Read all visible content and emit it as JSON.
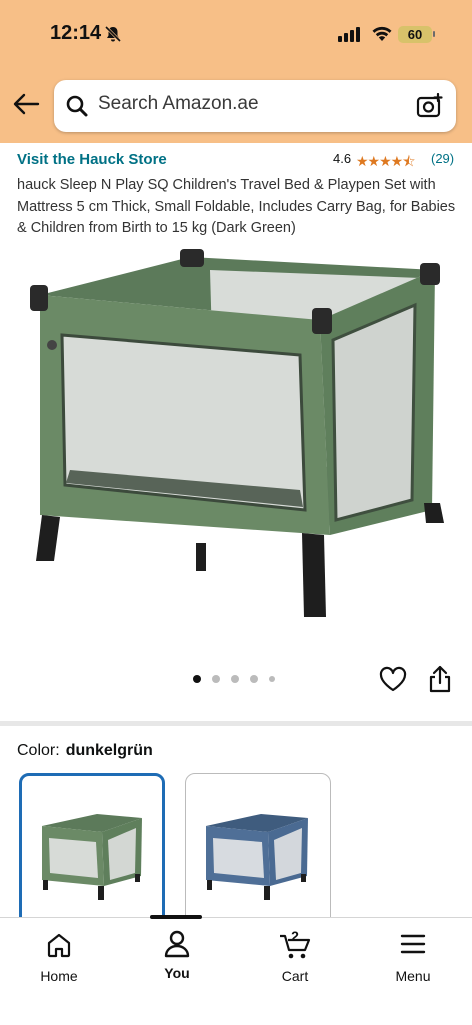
{
  "status_bar": {
    "time": "12:14",
    "battery": "60"
  },
  "search": {
    "placeholder": "Search Amazon.ae"
  },
  "product": {
    "store_link": "Visit the Hauck Store",
    "rating": "4.6",
    "stars": "★★★★⯪",
    "rating_count": "(29)",
    "title": "hauck Sleep N Play SQ Children's Travel Bed & Playpen Set with Mattress 5 cm Thick, Small Foldable, Includes Carry Bag, for Babies & Children from Birth to 15 kg (Dark Green)",
    "image_count": 5,
    "active_image": 1
  },
  "color": {
    "label": "Color:",
    "selected": "dunkelgrün"
  },
  "nav": {
    "home": "Home",
    "you": "You",
    "cart": "Cart",
    "cart_count": "2",
    "menu": "Menu"
  },
  "colors": {
    "header": "#f7bf87",
    "link": "#007185",
    "star": "#de7921",
    "selected_border": "#1e6cb5"
  }
}
